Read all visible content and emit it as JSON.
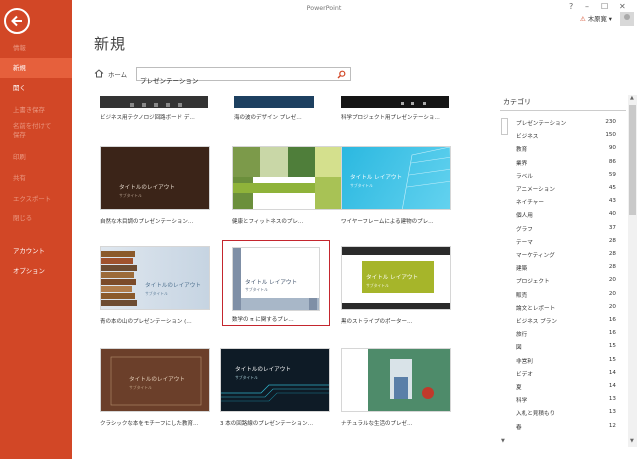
{
  "window": {
    "title": "PowerPoint",
    "help": "?",
    "minimize": "–",
    "restore": "☐",
    "close": "✕"
  },
  "user": {
    "warning": "⚠",
    "name": "木原寛",
    "dropdown": "▾"
  },
  "sidebar": {
    "items": [
      {
        "label": "情報"
      },
      {
        "label": "新規"
      },
      {
        "label": "開く"
      },
      {
        "label": "上書き保存"
      },
      {
        "label": "名前を付けて"
      },
      {
        "label": "保存"
      },
      {
        "label": "印刷"
      },
      {
        "label": "共有"
      },
      {
        "label": "エクスポート"
      },
      {
        "label": "閉じる"
      },
      {
        "label": "アカウント"
      },
      {
        "label": "オプション"
      }
    ]
  },
  "main": {
    "title": "新規",
    "home_label": "ホーム",
    "search": {
      "value": "プレゼンテーション",
      "placeholder": ""
    }
  },
  "templates": {
    "top_row": [
      {
        "caption": "ビジネス用テクノロジ回路ボード デ…"
      },
      {
        "caption": "海の波のデザイン プレゼ…"
      },
      {
        "caption": "科学プロジェクト用プレゼンテーショ…"
      }
    ],
    "items": [
      {
        "caption": "自然な木目調のプレゼンテーション…",
        "thumb_title": "タイトルのレイアウト",
        "thumb_sub": "サブタイトル"
      },
      {
        "caption": "健康とフィットネスのプレ…",
        "thumb_title": "",
        "thumb_sub": ""
      },
      {
        "caption": "ワイヤーフレームによる建物のプレ…",
        "thumb_title": "タイトル レイアウト",
        "thumb_sub": "サブタイトル"
      },
      {
        "caption": "青の本の山のプレゼンテーション (…",
        "thumb_title": "タイトルのレイアウト",
        "thumb_sub": "サブタイトル"
      },
      {
        "caption": "数学の π に関するプレ…",
        "thumb_title": "タイトル レイアウト",
        "thumb_sub": "サブタイトル"
      },
      {
        "caption": "黒のストライプのポーター…",
        "thumb_title": "タイトル レイアウト",
        "thumb_sub": "サブタイトル"
      },
      {
        "caption": "クラシックな本をモチーフにした教育…",
        "thumb_title": "タイトルのレイアウト",
        "thumb_sub": "サブタイトル"
      },
      {
        "caption": "3 本の回路線のプレゼンテーション…",
        "thumb_title": "タイトルのレイアウト",
        "thumb_sub": "サブタイトル"
      },
      {
        "caption": "ナチュラルな生活のプレゼ…",
        "thumb_title": "",
        "thumb_sub": ""
      }
    ]
  },
  "categories": {
    "header": "カテゴリ",
    "items": [
      {
        "name": "プレゼンテーション",
        "count": "230"
      },
      {
        "name": "ビジネス",
        "count": "150"
      },
      {
        "name": "教育",
        "count": "90"
      },
      {
        "name": "業界",
        "count": "86"
      },
      {
        "name": "ラベル",
        "count": "59"
      },
      {
        "name": "アニメーション",
        "count": "45"
      },
      {
        "name": "ネイチャー",
        "count": "43"
      },
      {
        "name": "個人用",
        "count": "40"
      },
      {
        "name": "グラフ",
        "count": "37"
      },
      {
        "name": "テーマ",
        "count": "28"
      },
      {
        "name": "マーケティング",
        "count": "28"
      },
      {
        "name": "建築",
        "count": "28"
      },
      {
        "name": "プロジェクト",
        "count": "20"
      },
      {
        "name": "販売",
        "count": "20"
      },
      {
        "name": "論文とレポート",
        "count": "20"
      },
      {
        "name": "ビジネス プラン",
        "count": "16"
      },
      {
        "name": "旅行",
        "count": "16"
      },
      {
        "name": "図",
        "count": "15"
      },
      {
        "name": "非営利",
        "count": "15"
      },
      {
        "name": "ビデオ",
        "count": "14"
      },
      {
        "name": "夏",
        "count": "14"
      },
      {
        "name": "科学",
        "count": "13"
      },
      {
        "name": "入札と見積もり",
        "count": "13"
      },
      {
        "name": "春",
        "count": "12"
      }
    ]
  },
  "colors": {
    "accent": "#d24726",
    "sidebar_active": "#e6603c",
    "selected_border": "#c4262e"
  }
}
